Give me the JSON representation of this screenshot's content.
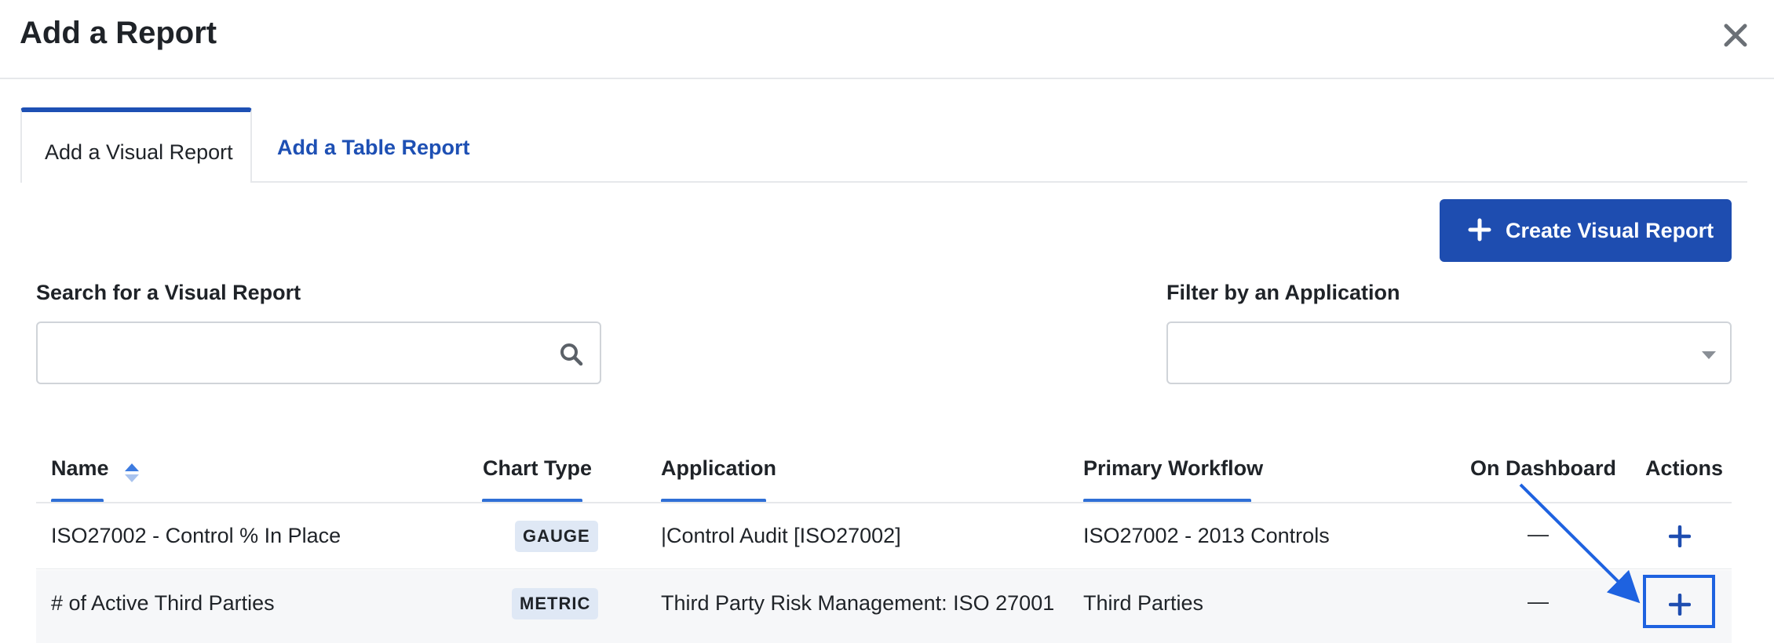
{
  "dialog": {
    "title": "Add a Report"
  },
  "tabs": [
    {
      "label": "Add a Visual Report",
      "active": true
    },
    {
      "label": "Add a Table Report",
      "active": false
    }
  ],
  "toolbar": {
    "create_label": "Create Visual Report"
  },
  "search": {
    "label": "Search for a Visual Report",
    "value": "",
    "placeholder": ""
  },
  "filter": {
    "label": "Filter by an Application",
    "value": ""
  },
  "table": {
    "columns": {
      "name": "Name",
      "chart_type": "Chart Type",
      "application": "Application",
      "primary_workflow": "Primary Workflow",
      "on_dashboard": "On Dashboard",
      "actions": "Actions"
    },
    "rows": [
      {
        "name": "ISO27002 - Control % In Place",
        "chart_type": "GAUGE",
        "application": "|Control Audit [ISO27002]",
        "primary_workflow": "ISO27002 - 2013 Controls",
        "on_dashboard": "—"
      },
      {
        "name": "# of Active Third Parties",
        "chart_type": "METRIC",
        "application": "Third Party Risk Management: ISO 27001",
        "primary_workflow": "Third Parties",
        "on_dashboard": "—"
      }
    ]
  },
  "colors": {
    "accent": "#1e4db0",
    "tab_link": "#1e50b4",
    "badge_bg": "#dfe8f5",
    "highlight": "#1e62e0"
  },
  "icons": {
    "close": "close-icon",
    "create": "plus-icon",
    "search": "search-icon",
    "filter": "chevron-down-icon",
    "sort": "sort-icon",
    "add": "plus-icon"
  }
}
